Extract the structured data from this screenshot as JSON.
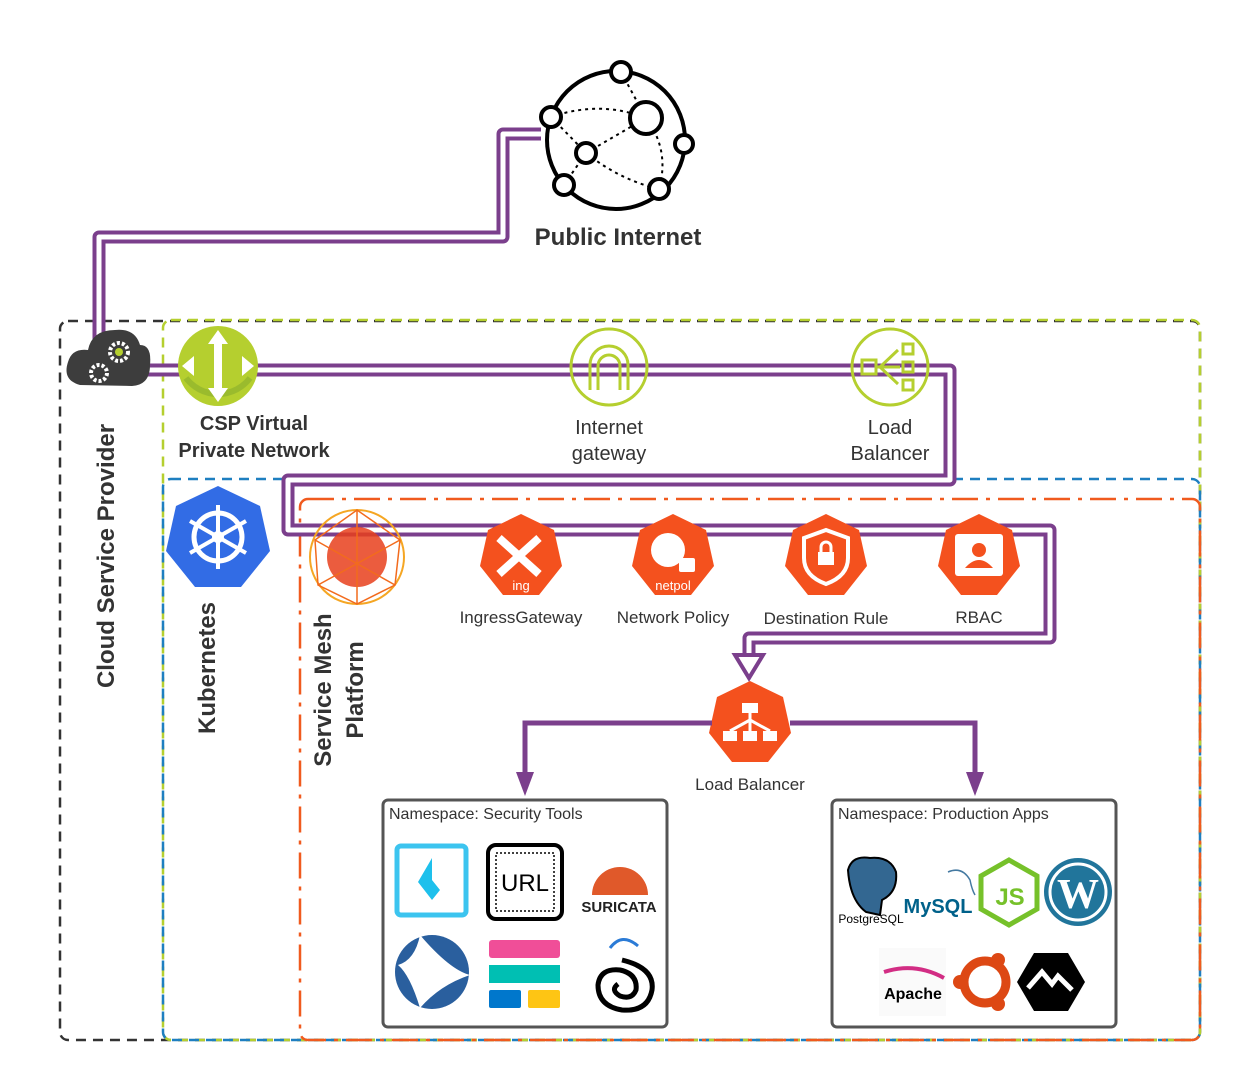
{
  "public_internet": {
    "label": "Public Internet",
    "icon": "globe-network-icon"
  },
  "containers": {
    "csp": {
      "label": "Cloud Service Provider",
      "icon": "cloud-gears-icon",
      "color": "#333333"
    },
    "vpn": {
      "label_line1": "CSP Virtual",
      "label_line2": "Private Network",
      "icon": "router-icon",
      "color": "#b5cf2f"
    },
    "kubernetes": {
      "label": "Kubernetes",
      "icon": "kubernetes-helm-icon",
      "color": "#1e7fc0"
    },
    "service_mesh": {
      "label_line1": "Service Mesh",
      "label_line2": "Platform",
      "icon": "mesh-sphere-icon",
      "color": "#f05a1e"
    }
  },
  "vpc_components": [
    {
      "label_line1": "Internet",
      "label_line2": "gateway",
      "icon": "internet-gateway-icon"
    },
    {
      "label_line1": "Load",
      "label_line2": "Balancer",
      "icon": "load-balancer-icon"
    }
  ],
  "mesh_components": [
    {
      "label": "IngressGateway",
      "badge": "ing",
      "icon": "ingress-icon"
    },
    {
      "label": "Network Policy",
      "badge": "netpol",
      "icon": "network-policy-icon"
    },
    {
      "label": "Destination Rule",
      "icon": "lock-shield-icon"
    },
    {
      "label": "RBAC",
      "icon": "user-badge-icon"
    }
  ],
  "mesh_load_balancer": {
    "label": "Load Balancer",
    "icon": "load-balancer-tree-icon"
  },
  "namespaces": [
    {
      "title": "Namespace: Security Tools",
      "apps": [
        "falco",
        "URL",
        "SURICATA",
        "wireshark",
        "elastic",
        "sysdig"
      ]
    },
    {
      "title": "Namespace: Production Apps",
      "apps": [
        "PostgreSQL",
        "MySQL",
        "JS",
        "wordpress",
        "Apache",
        "ubuntu",
        "mattermost"
      ]
    }
  ],
  "colors": {
    "flow": "#7b3f8c",
    "k8s_orange": "#f4511e",
    "green": "#b5cf2f",
    "blue": "#1e7fc0"
  }
}
